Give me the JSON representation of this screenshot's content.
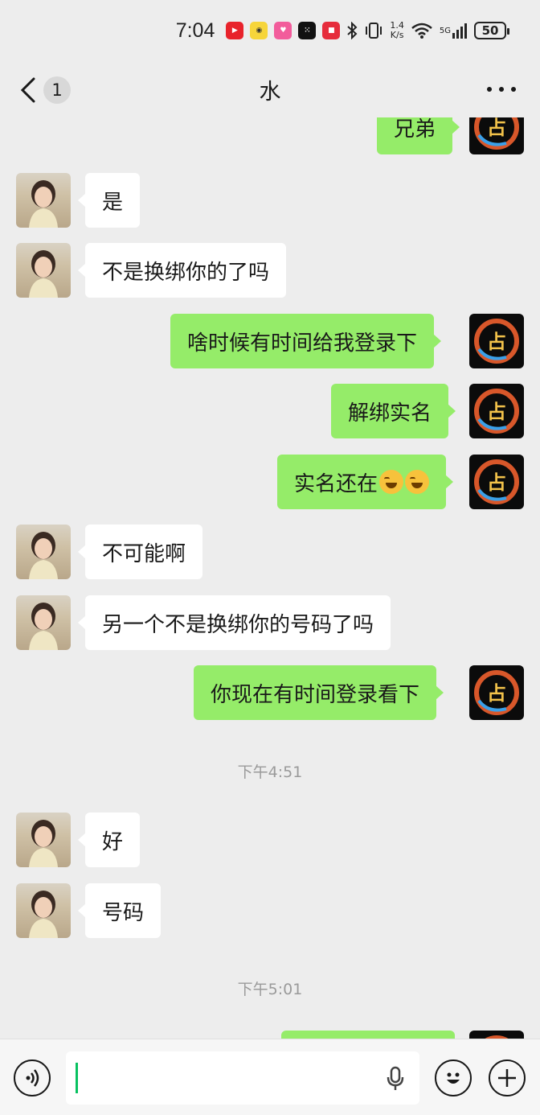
{
  "status_bar": {
    "time": "7:04",
    "app_icons": [
      {
        "name": "video-app-icon",
        "color": "#e8232b"
      },
      {
        "name": "reader-app-icon",
        "color": "#f6d53a"
      },
      {
        "name": "pink-app-icon",
        "color": "#f25c9b"
      },
      {
        "name": "dice-app-icon",
        "color": "#111111"
      },
      {
        "name": "xiaohongshu-app-icon",
        "color": "#e62b3b"
      }
    ],
    "net_speed_value": "1.4",
    "net_speed_unit": "K/s",
    "signal_label": "5G",
    "battery": "50"
  },
  "header": {
    "unread_count": "1",
    "title": "水"
  },
  "messages": [
    {
      "side": "right",
      "text": "兄弟"
    },
    {
      "side": "left",
      "text": "是"
    },
    {
      "side": "left",
      "text": "不是换绑你的了吗"
    },
    {
      "side": "right",
      "text": "啥时候有时间给我登录下"
    },
    {
      "side": "right",
      "text": "解绑实名"
    },
    {
      "side": "right",
      "text": "实名还在",
      "emojis": [
        "rofl-emoji",
        "rofl-emoji"
      ]
    },
    {
      "side": "left",
      "text": "不可能啊"
    },
    {
      "side": "left",
      "text": "另一个不是换绑你的号码了吗"
    },
    {
      "side": "right",
      "text": "你现在有时间登录看下"
    },
    {
      "side": "left",
      "text": "好"
    },
    {
      "side": "left",
      "text": "号码"
    },
    {
      "side": "right",
      "text": ""
    }
  ],
  "timestamps": [
    "下午4:51",
    "下午5:01"
  ],
  "input": {
    "value": "",
    "voice_icon": "voice-icon",
    "emoji_icon": "emoji-icon",
    "plus_icon": "plus-icon",
    "mic_icon": "mic-icon"
  },
  "colors": {
    "background": "#ededed",
    "sent_bubble": "#95ec69",
    "received_bubble": "#ffffff",
    "timestamp": "#9a9a9a",
    "cursor": "#07c160"
  }
}
